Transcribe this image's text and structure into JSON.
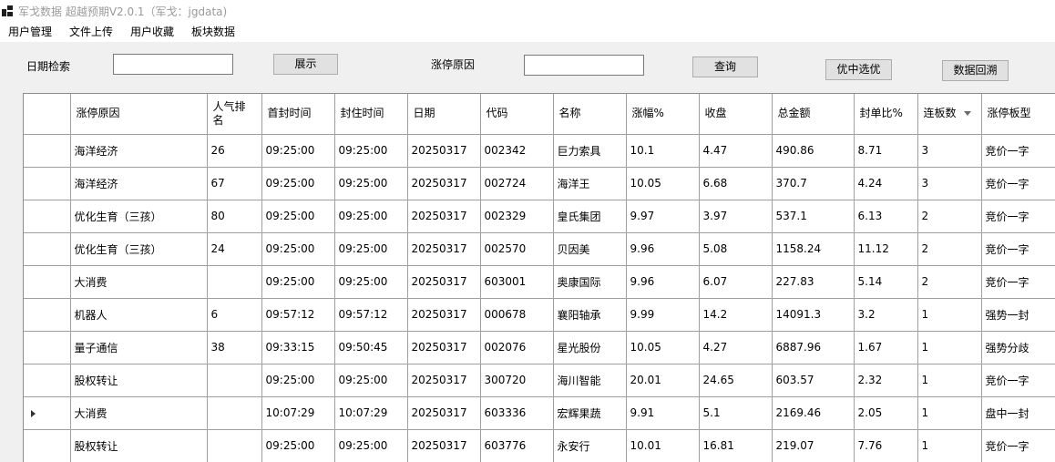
{
  "window": {
    "title": "军戈数据 超越预期V2.0.1（军戈：jgdata)"
  },
  "menu": [
    "用户管理",
    "文件上传",
    "用户收藏",
    "板块数据"
  ],
  "toolbar": {
    "date_label": "日期检索",
    "date_value": "",
    "show_button": "展示",
    "reason_label": "涨停原因",
    "reason_value": "",
    "query_button": "查询",
    "select_button": "优中选优",
    "backtrack_button": "数据回溯"
  },
  "table": {
    "columns": [
      "涨停原因",
      "人气排名",
      "首封时间",
      "封住时间",
      "日期",
      "代码",
      "名称",
      "涨幅%",
      "收盘",
      "总金额",
      "封单比%",
      "连板数",
      "涨停板型"
    ],
    "current_row": 8,
    "rows": [
      [
        "海洋经济",
        "26",
        "09:25:00",
        "09:25:00",
        "20250317",
        "002342",
        "巨力索具",
        "10.1",
        "4.47",
        "490.86",
        "8.71",
        "3",
        "竞价一字"
      ],
      [
        "海洋经济",
        "67",
        "09:25:00",
        "09:25:00",
        "20250317",
        "002724",
        "海洋王",
        "10.05",
        "6.68",
        "370.7",
        "4.24",
        "3",
        "竞价一字"
      ],
      [
        "优化生育（三孩）",
        "80",
        "09:25:00",
        "09:25:00",
        "20250317",
        "002329",
        "皇氏集团",
        "9.97",
        "3.97",
        "537.1",
        "6.13",
        "2",
        "竞价一字"
      ],
      [
        "优化生育（三孩）",
        "24",
        "09:25:00",
        "09:25:00",
        "20250317",
        "002570",
        "贝因美",
        "9.96",
        "5.08",
        "1158.24",
        "11.12",
        "2",
        "竞价一字"
      ],
      [
        "大消费",
        "",
        "09:25:00",
        "09:25:00",
        "20250317",
        "603001",
        "奥康国际",
        "9.96",
        "6.07",
        "227.83",
        "5.14",
        "2",
        "竞价一字"
      ],
      [
        "机器人",
        "6",
        "09:57:12",
        "09:57:12",
        "20250317",
        "000678",
        "襄阳轴承",
        "9.99",
        "14.2",
        "14091.3",
        "3.2",
        "1",
        "强势一封"
      ],
      [
        "量子通信",
        "38",
        "09:33:15",
        "09:50:45",
        "20250317",
        "002076",
        "星光股份",
        "10.05",
        "4.27",
        "6887.96",
        "1.67",
        "1",
        "强势分歧"
      ],
      [
        "股权转让",
        "",
        "09:25:00",
        "09:25:00",
        "20250317",
        "300720",
        "海川智能",
        "20.01",
        "24.65",
        "603.57",
        "2.32",
        "1",
        "竞价一字"
      ],
      [
        "大消费",
        "",
        "10:07:29",
        "10:07:29",
        "20250317",
        "603336",
        "宏辉果蔬",
        "9.91",
        "5.1",
        "2169.46",
        "2.05",
        "1",
        "盘中一封"
      ],
      [
        "股权转让",
        "",
        "09:25:00",
        "09:25:00",
        "20250317",
        "603776",
        "永安行",
        "10.01",
        "16.81",
        "219.07",
        "7.76",
        "1",
        "竞价一字"
      ]
    ]
  }
}
